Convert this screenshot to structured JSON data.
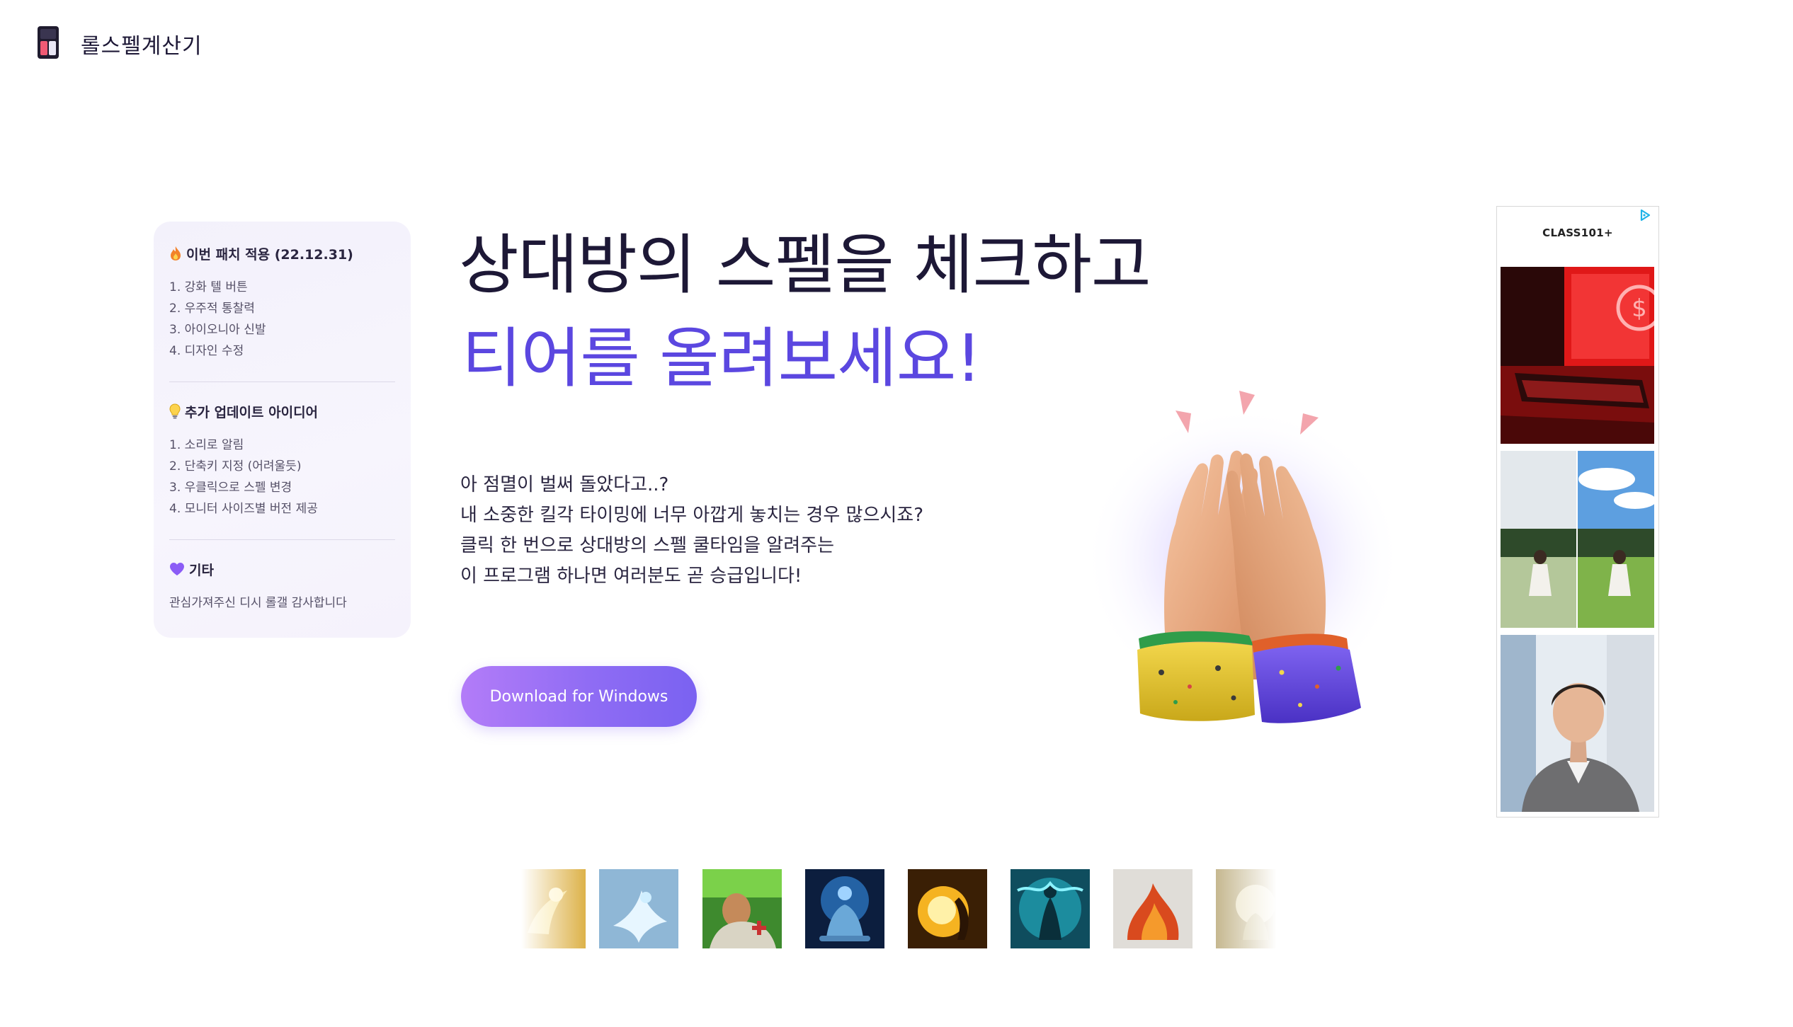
{
  "header": {
    "brand_name": "롤스펠계산기",
    "logo_icon": "app-logo-icon"
  },
  "patch_notes": {
    "sections": [
      {
        "icon": "fire-icon",
        "title": "이번 패치 적용 (22.12.31)",
        "items": [
          "1. 강화 텔 버튼",
          "2. 우주적 통찰력",
          "3. 아이오니아 신발",
          "4. 디자인 수정"
        ]
      },
      {
        "icon": "lightbulb-icon",
        "title": "추가 업데이트 아이디어",
        "items": [
          "1. 소리로 알림",
          "2. 단축키 지정 (어려울듯)",
          "3. 우클릭으로 스펠 변경",
          "4. 모니터 사이즈별 버전 제공"
        ]
      },
      {
        "icon": "purple-heart-icon",
        "title": "기타",
        "text": "관심가져주신 디시 롤갤 감사합니다"
      }
    ]
  },
  "hero": {
    "headline_line1": "상대방의 스펠을 체크하고",
    "headline_line2": "티어를 올려보세요!",
    "description_lines": [
      "아 점멸이 벌써 돌았다고..?",
      "내 소중한 킬각 타이밍에 너무 아깝게 놓치는 경우 많으시죠?",
      "클릭 한 번으로 상대방의 스펠 쿨타임을 알려주는",
      "이 프로그램 하나면 여러분도 곧 승급입니다!"
    ],
    "download_label": "Download for Windows",
    "illustration": "high-five-hands-illustration"
  },
  "ad": {
    "brand": "CLASS101+",
    "choices_icon": "ad-choices-icon",
    "images": [
      "red-gaming-pc-ad-image",
      "girl-in-field-ad-image",
      "man-in-suit-ad-image"
    ]
  },
  "spells": {
    "icons": [
      "ghost-spell-icon",
      "flash-spell-icon",
      "heal-spell-icon",
      "clarity-spell-icon",
      "ignite-spell-icon",
      "barrier-spell-icon",
      "smite-spell-icon",
      "cleanse-spell-icon"
    ]
  },
  "colors": {
    "accent_purple": "#5b47e0",
    "button_gradient_start": "#b37cf8",
    "button_gradient_end": "#7a62f1",
    "card_background": "#f4f2fc"
  }
}
